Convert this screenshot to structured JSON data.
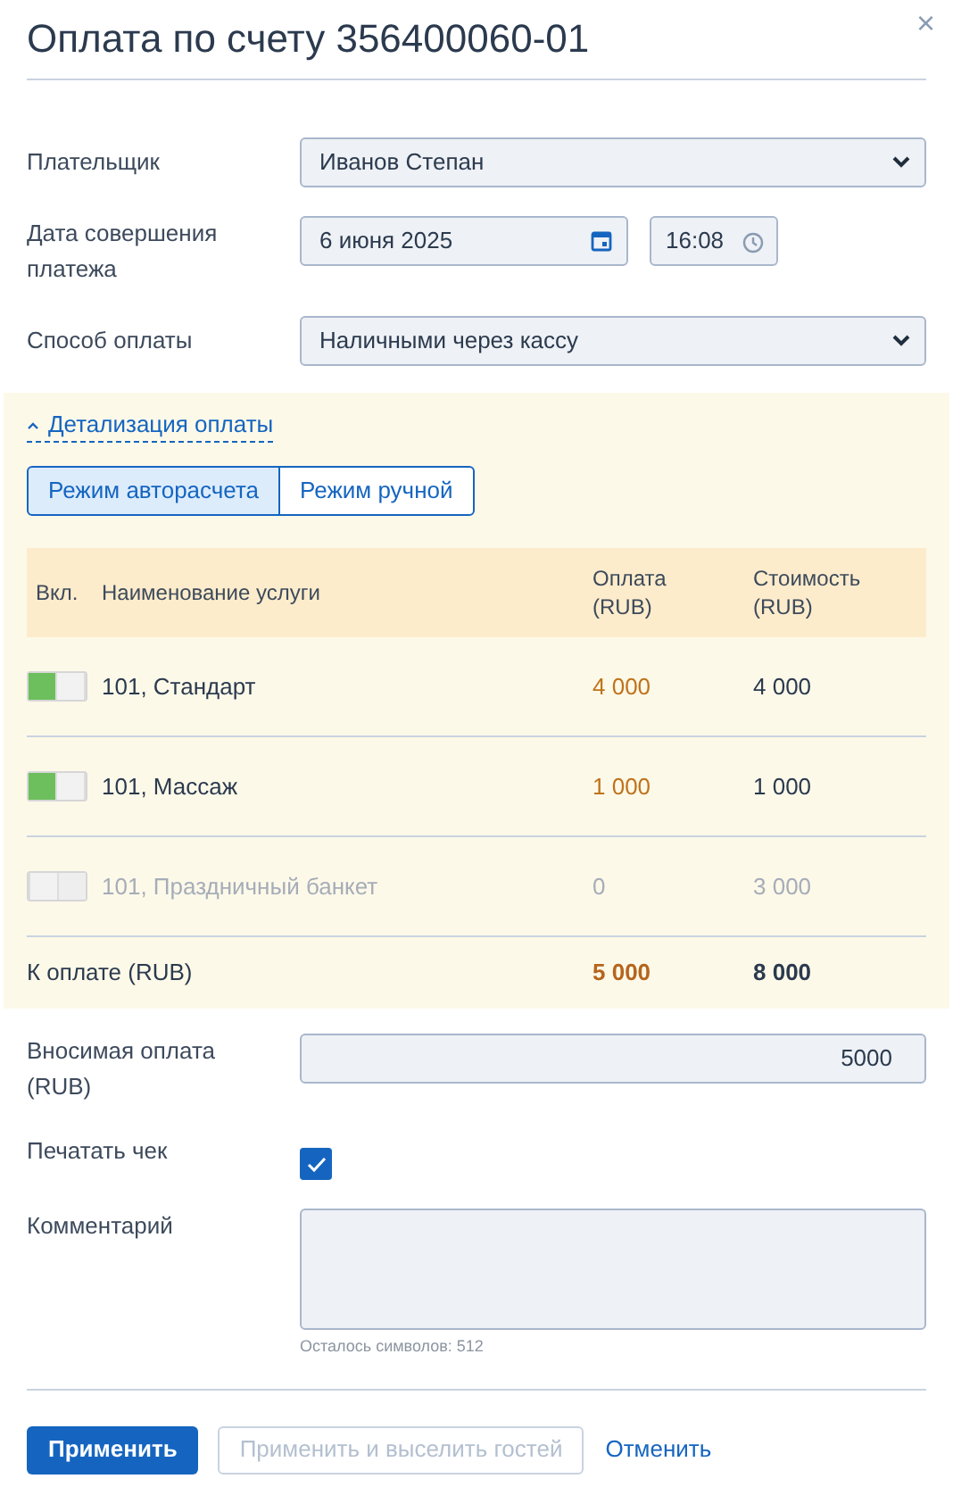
{
  "title": "Оплата по счету 356400060-01",
  "close": "×",
  "payer": {
    "label": "Плательщик",
    "value": "Иванов Степан"
  },
  "date": {
    "label": "Дата совершения платежа",
    "value": "6 июня 2025",
    "time": "16:08"
  },
  "method": {
    "label": "Способ оплаты",
    "value": "Наличными через кассу"
  },
  "details": {
    "toggle": "Детализация оплаты",
    "expanded": true,
    "modes": [
      {
        "label": "Режим авторасчета",
        "selected": true
      },
      {
        "label": "Режим ручной",
        "selected": false
      }
    ],
    "columns": [
      "Вкл.",
      "Наименование услуги",
      "Оплата (RUB)",
      "Стоимость (RUB)"
    ],
    "rows": [
      {
        "on": true,
        "name": "101, Стандарт",
        "payment": "4 000",
        "cost": "4 000"
      },
      {
        "on": true,
        "name": "101, Массаж",
        "payment": "1 000",
        "cost": "1 000"
      },
      {
        "on": false,
        "name": "101, Праздничный банкет",
        "payment": "0",
        "cost": "3 000"
      }
    ],
    "total": {
      "label": "К оплате (RUB)",
      "payment": "5 000",
      "cost": "8 000"
    }
  },
  "amount": {
    "label": "Вносимая оплата (RUB)",
    "value": "5000"
  },
  "print": {
    "label": "Печатать чек",
    "checked": true
  },
  "comment": {
    "label": "Комментарий",
    "counter": "Осталось символов: 512"
  },
  "buttons": [
    {
      "label": "Применить",
      "kind": "primary",
      "disabled": false
    },
    {
      "label": "Применить и выселить гостей",
      "kind": "secondary",
      "disabled": true
    },
    {
      "label": "Отменить",
      "kind": "link",
      "disabled": false
    }
  ]
}
